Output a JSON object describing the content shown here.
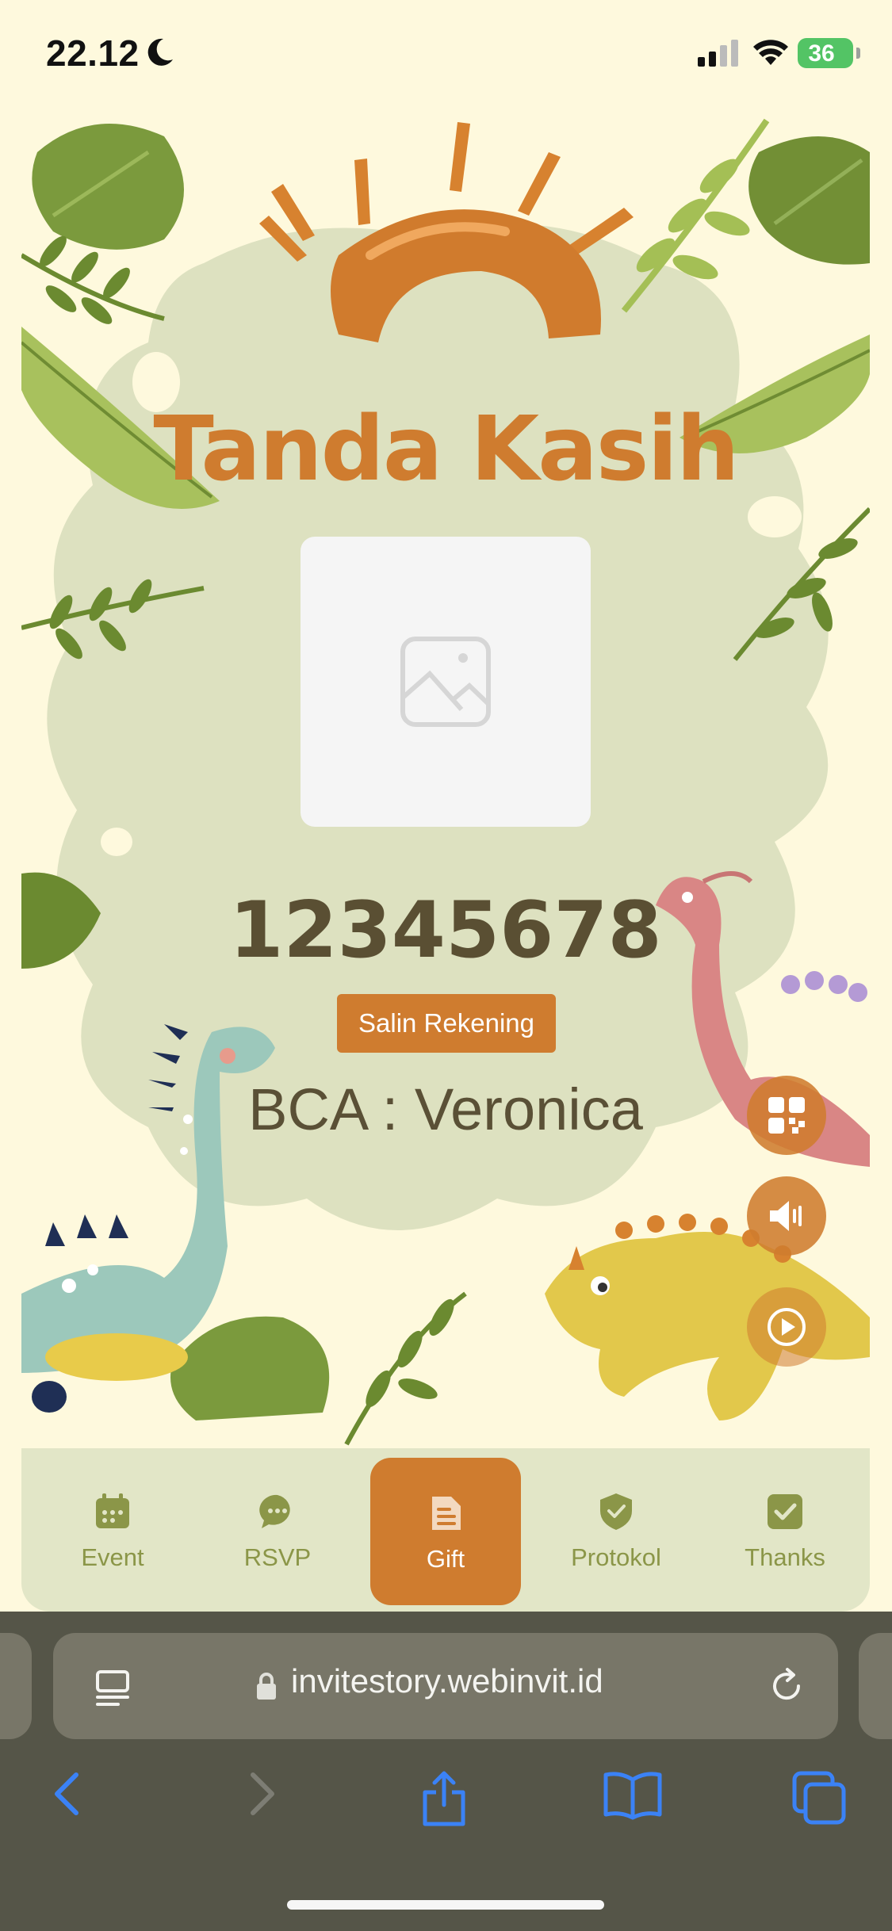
{
  "status_bar": {
    "time": "22.12",
    "battery": "36"
  },
  "page": {
    "title": "Tanda Kasih",
    "account_number": "12345678",
    "copy_button_label": "Salin Rekening",
    "bank_name": "BCA : Veronica"
  },
  "floating_buttons": {
    "qr": "qr-code-icon",
    "sound": "speaker-icon",
    "play": "play-icon"
  },
  "bottom_nav": {
    "items": [
      {
        "label": "Event",
        "icon": "calendar-icon"
      },
      {
        "label": "RSVP",
        "icon": "chat-icon"
      },
      {
        "label": "Gift",
        "icon": "gift-icon",
        "active": true
      },
      {
        "label": "Protokol",
        "icon": "shield-check-icon"
      },
      {
        "label": "Thanks",
        "icon": "check-badge-icon"
      }
    ]
  },
  "browser": {
    "url": "invitestory.webinvit.id"
  },
  "colors": {
    "accent": "#cf7c2f",
    "background": "#fef9dd",
    "leaf": "#7f9b3e",
    "nav_text": "#8b9648"
  }
}
